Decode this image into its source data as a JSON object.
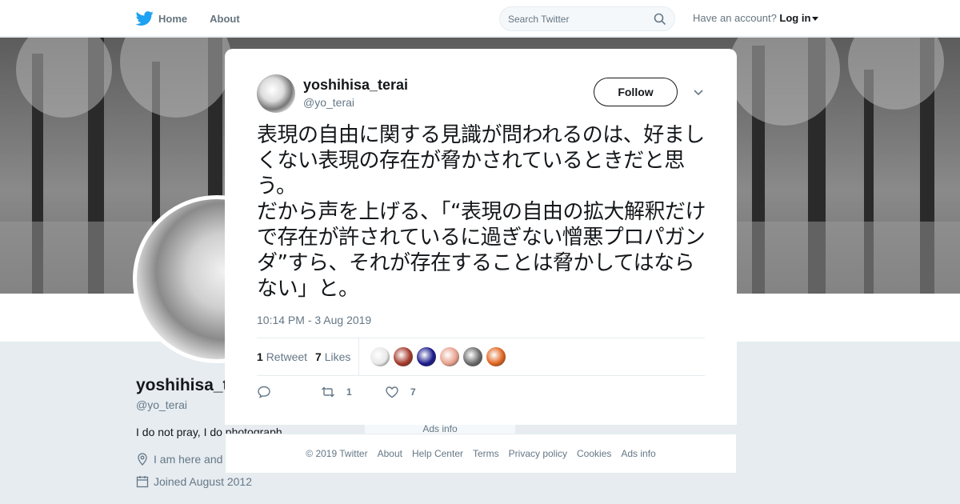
{
  "nav": {
    "home_label": "Home",
    "about_label": "About",
    "search_placeholder": "Search Twitter",
    "account_prompt": "Have an account?",
    "login_label": "Log in"
  },
  "profile": {
    "name": "yoshihisa_t",
    "handle": "@yo_terai",
    "bio": "I do not pray, I do photograph",
    "location": "I am here and",
    "joined": "Joined August 2012",
    "ads_info": "Ads info"
  },
  "tweet": {
    "author_name": "yoshihisa_terai",
    "author_handle": "@yo_terai",
    "follow_label": "Follow",
    "text": "表現の自由に関する見識が問われるのは、好ましくない表現の存在が脅かされているときだと思う。\nだから声を上げる、「“表現の自由の拡大解釈だけで存在が許されているに過ぎない憎悪プロパガンダ”すら、それが存在することは脅かしてはならない」と。",
    "timestamp": "10:14 PM - 3 Aug 2019",
    "retweet_count": "1",
    "retweet_label": "Retweet",
    "like_count": "7",
    "like_label": "Likes",
    "action_retweets": "1",
    "action_likes": "7"
  },
  "likers": [
    {
      "color": "#e8e8e8",
      "icon": "snail-avatar"
    },
    {
      "color": "#a4382a",
      "icon": "avatar"
    },
    {
      "color": "#1a1a8c",
      "icon": "avatar"
    },
    {
      "color": "#e7a08c",
      "icon": "avatar"
    },
    {
      "color": "#6a6a6a",
      "icon": "avatar"
    },
    {
      "color": "#e0641e",
      "icon": "avatar"
    }
  ],
  "footer": {
    "copyright": "© 2019 Twitter",
    "about": "About",
    "help": "Help Center",
    "terms": "Terms",
    "privacy": "Privacy policy",
    "cookies": "Cookies",
    "ads": "Ads info"
  },
  "colors": {
    "brand": "#1da1f2",
    "text_secondary": "#657786"
  }
}
